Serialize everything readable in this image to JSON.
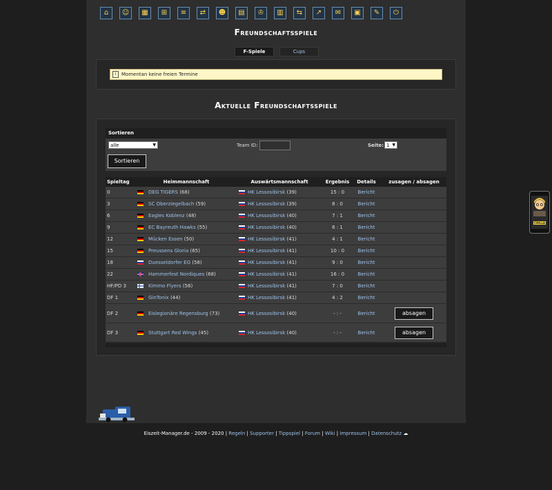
{
  "toolbar": {
    "icons": [
      "home-icon",
      "team-icon",
      "lineup-icon",
      "training-icon",
      "list-icon",
      "transfer-icon",
      "youth-icon",
      "arena-icon",
      "cup-icon",
      "finance-icon",
      "trade-icon",
      "statistics-icon",
      "mail-icon",
      "schedule-icon",
      "chat-icon",
      "logout-icon"
    ],
    "glyphs": [
      "⌂",
      "☺",
      "▦",
      "⊞",
      "≡",
      "⇄",
      "☻",
      "▤",
      "♔",
      "▥",
      "⇆",
      "↗",
      "✉",
      "▣",
      "✎",
      "⏻"
    ]
  },
  "page_title": "Freundschaftsspiele",
  "tabs": [
    {
      "label": "F-Spiele",
      "active": true
    },
    {
      "label": "Cups",
      "active": false
    }
  ],
  "notice": {
    "text": "Momentan keine freien Termine"
  },
  "section_title": "Aktuelle Freundschaftsspiele",
  "filter": {
    "header": "Sortieren",
    "select_value": "alle",
    "team_id_label": "Team ID:",
    "team_id_value": "",
    "page_label": "Seite:",
    "page_value": "1",
    "button": "Sortieren"
  },
  "table": {
    "headers": [
      "Spieltag",
      "Heimmannschaft",
      "Auswärtsmannschaft",
      "Ergebnis",
      "Details",
      "zusagen / absagen"
    ],
    "rows": [
      {
        "day": "0",
        "home_flag": "de",
        "home": "DEG TIGERS",
        "home_strength": "(68)",
        "away_flag": "ru",
        "away": "HK Lessosibirsk",
        "away_strength": "(39)",
        "result": "15 : 0",
        "details": "Bericht",
        "action": ""
      },
      {
        "day": "3",
        "home_flag": "de",
        "home": "SC Oberziegelbach",
        "home_strength": "(59)",
        "away_flag": "ru",
        "away": "HK Lessosibirsk",
        "away_strength": "(39)",
        "result": "8 : 0",
        "details": "Bericht",
        "action": ""
      },
      {
        "day": "6",
        "home_flag": "de",
        "home": "Eagles Koblenz",
        "home_strength": "(48)",
        "away_flag": "ru",
        "away": "HK Lessosibirsk",
        "away_strength": "(40)",
        "result": "7 : 1",
        "details": "Bericht",
        "action": ""
      },
      {
        "day": "9",
        "home_flag": "de",
        "home": "EC Bayreuth Hawks",
        "home_strength": "(55)",
        "away_flag": "ru",
        "away": "HK Lessosibirsk",
        "away_strength": "(40)",
        "result": "6 : 1",
        "details": "Bericht",
        "action": ""
      },
      {
        "day": "12",
        "home_flag": "de",
        "home": "Mücken Essen",
        "home_strength": "(50)",
        "away_flag": "ru",
        "away": "HK Lessosibirsk",
        "away_strength": "(41)",
        "result": "4 : 1",
        "details": "Bericht",
        "action": ""
      },
      {
        "day": "15",
        "home_flag": "de",
        "home": "Preussens Gloria",
        "home_strength": "(65)",
        "away_flag": "ru",
        "away": "HK Lessosibirsk",
        "away_strength": "(41)",
        "result": "10 : 0",
        "details": "Bericht",
        "action": ""
      },
      {
        "day": "18",
        "home_flag": "ru",
        "home": "Duesseldorfer EG",
        "home_strength": "(58)",
        "away_flag": "ru",
        "away": "HK Lessosibirsk",
        "away_strength": "(41)",
        "result": "9 : 0",
        "details": "Bericht",
        "action": ""
      },
      {
        "day": "22",
        "home_flag": "gb",
        "home": "Hammerfest Nordiques",
        "home_strength": "(68)",
        "away_flag": "ru",
        "away": "HK Lessosibirsk",
        "away_strength": "(41)",
        "result": "16 : 0",
        "details": "Bericht",
        "action": ""
      },
      {
        "day": "HF/PD 3",
        "home_flag": "fi",
        "home": "Kimmo Flyers",
        "home_strength": "(56)",
        "away_flag": "ru",
        "away": "HK Lessosibirsk",
        "away_strength": "(41)",
        "result": "7 : 0",
        "details": "Bericht",
        "action": ""
      },
      {
        "day": "DF 1",
        "home_flag": "de",
        "home": "GinTonix",
        "home_strength": "(44)",
        "away_flag": "ru",
        "away": "HK Lessosibirsk",
        "away_strength": "(41)",
        "result": "4 : 2",
        "details": "Bericht",
        "action": ""
      },
      {
        "day": "DF 2",
        "home_flag": "de",
        "home": "Eislegionäre Regensburg",
        "home_strength": "(73)",
        "away_flag": "ru",
        "away": "HK Lessosibirsk",
        "away_strength": "(40)",
        "result": "- : -",
        "details": "Bericht",
        "action": "absagen"
      },
      {
        "day": "DF 3",
        "home_flag": "de",
        "home": "Stuttgart Red Wings",
        "home_strength": "(45)",
        "away_flag": "ru",
        "away": "HK Lessosibirsk",
        "away_strength": "(40)",
        "result": "- : -",
        "details": "Bericht",
        "action": "absagen"
      }
    ]
  },
  "footer": {
    "copyright": "Eiszeit-Manager.de - 2009 - 2020",
    "sep": "|",
    "links": [
      "Regeln",
      "Supporter",
      "Tippspiel",
      "Forum",
      "Wiki",
      "Impressum",
      "Datenschutz"
    ],
    "weather_glyph": "☁"
  },
  "phone_widget": {
    "label": "CHILLA"
  },
  "colors": {
    "link": "#9ec3ec",
    "notice_bg": "#fff7c7",
    "background": "#1e1e1e",
    "panel": "#2e2e2e"
  }
}
